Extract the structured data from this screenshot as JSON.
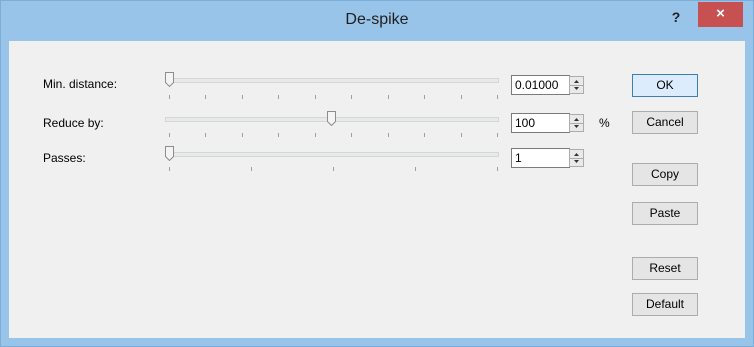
{
  "window": {
    "title": "De-spike",
    "help_label": "?",
    "close_label": "×"
  },
  "rows": [
    {
      "label": "Min. distance:",
      "value": "0.01000",
      "unit": "",
      "slider_fraction": 0.0
    },
    {
      "label": "Reduce by:",
      "value": "100",
      "unit": "%",
      "slider_fraction": 0.5
    },
    {
      "label": "Passes:",
      "value": "1",
      "unit": "",
      "slider_fraction": 0.0
    }
  ],
  "buttons": {
    "ok": "OK",
    "cancel": "Cancel",
    "copy": "Copy",
    "paste": "Paste",
    "reset": "Reset",
    "default": "Default"
  },
  "icons": {
    "help": "help-icon",
    "close": "close-icon",
    "spin_up": "spin-up-icon",
    "spin_down": "spin-down-icon"
  },
  "colors": {
    "titlebar": "#99c4ea",
    "close": "#c75050",
    "client": "#f0f0f0"
  }
}
